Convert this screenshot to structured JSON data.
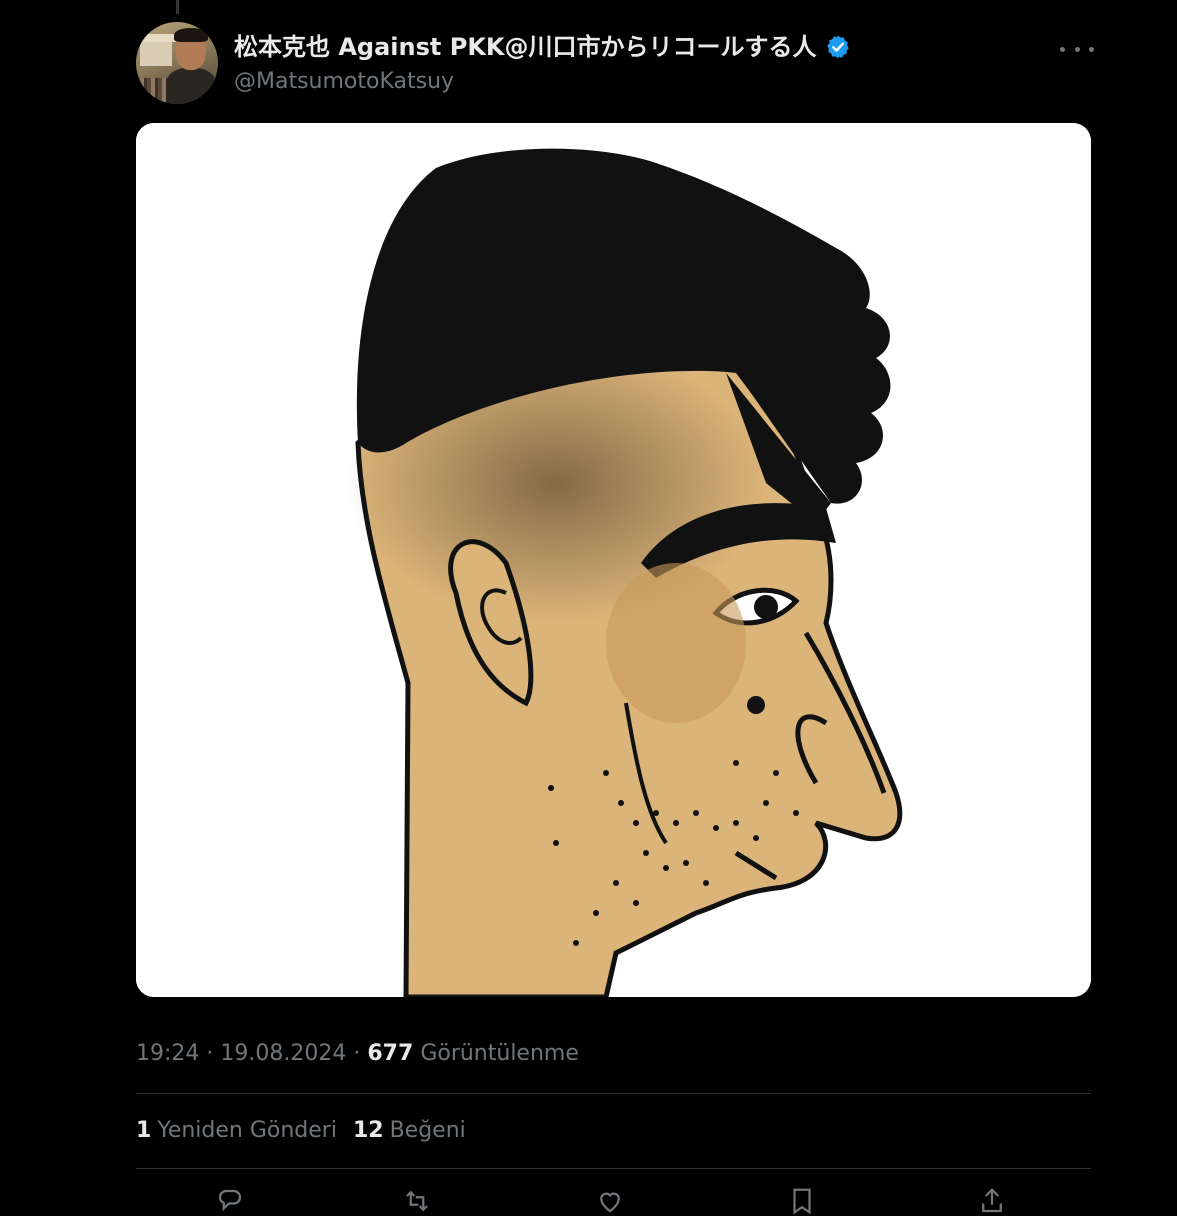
{
  "tweet": {
    "author_name": "松本克也 Against PKK@川口市からリコールする人",
    "handle": "@MatsumotoKatsuy",
    "time": "19:24",
    "date": "19.08.2024",
    "views_count": "677",
    "views_label": "Görüntülenme",
    "separator": "·"
  },
  "engagement": {
    "reposts_count": "1",
    "reposts_label": "Yeniden Gönderi",
    "likes_count": "12",
    "likes_label": "Beğeni"
  },
  "icons": {
    "verified": "verified-badge-icon",
    "more": "more-options-icon",
    "reply": "reply-icon",
    "repost": "repost-icon",
    "like": "like-icon",
    "bookmark": "bookmark-icon",
    "share": "share-icon"
  },
  "colors": {
    "background": "#000000",
    "text_primary": "#e7e9ea",
    "text_secondary": "#71767b",
    "verified_blue": "#1d9bf0",
    "divider": "#2f3336"
  }
}
